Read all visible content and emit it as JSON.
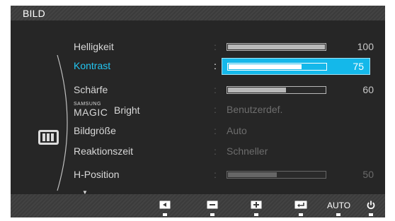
{
  "menu": {
    "title": "BILD",
    "scroll_indicator": "▼"
  },
  "items": [
    {
      "label": "Helligkeit",
      "slider_value": 100,
      "value_label": "100",
      "type": "slider"
    },
    {
      "label": "Kontrast",
      "slider_value": 75,
      "value_label": "75",
      "type": "slider",
      "selected": true
    },
    {
      "label": "Schärfe",
      "slider_value": 60,
      "value_label": "60",
      "type": "slider"
    },
    {
      "label_small": "SAMSUNG",
      "label_big": "MAGIC",
      "label_suffix": "Bright",
      "value_text": "Benutzerdef.",
      "type": "text"
    },
    {
      "label": "Bildgröße",
      "value_text": "Auto",
      "type": "text"
    },
    {
      "label": "Reaktionszeit",
      "value_text": "Schneller",
      "type": "text"
    },
    {
      "label": "H-Position",
      "slider_value": 50,
      "value_label": "50",
      "type": "slider",
      "dim": true
    }
  ],
  "separator": ":",
  "buttons": {
    "left": "left-arrow-icon",
    "minus": "minus-icon",
    "plus": "plus-icon",
    "enter": "enter-icon",
    "auto_label": "AUTO",
    "power": "power-icon"
  },
  "colors": {
    "selected_text": "#23c6f2",
    "selected_bg": "#14b8ea",
    "panel_bg": "#262626"
  }
}
